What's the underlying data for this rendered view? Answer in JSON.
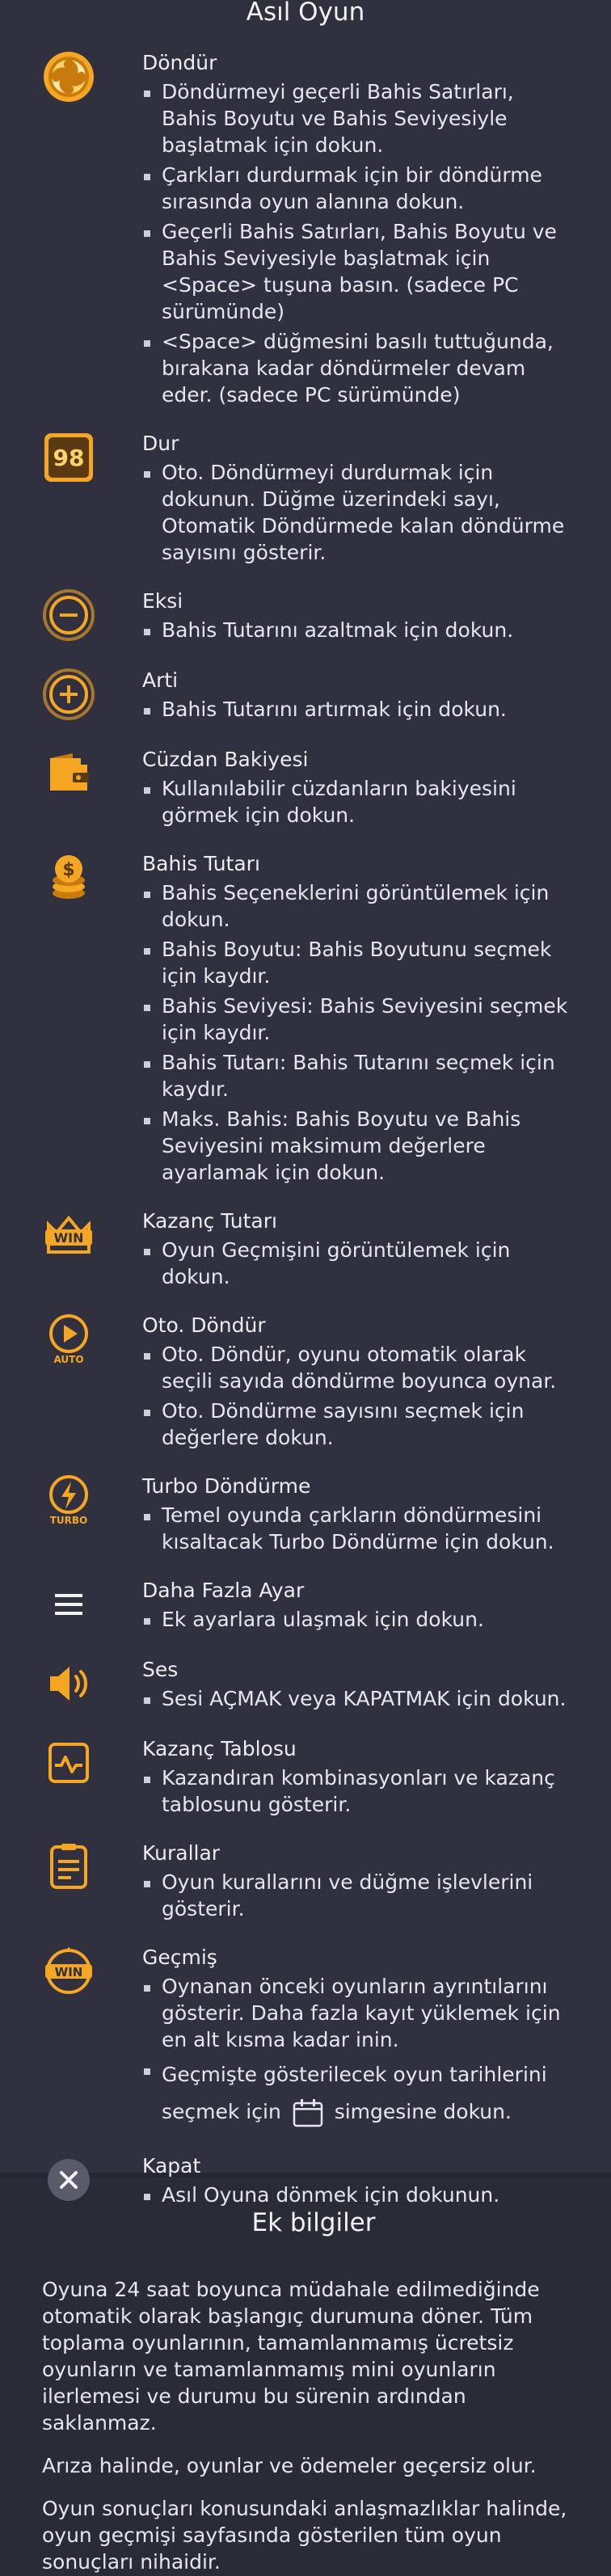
{
  "main_title": "Asıl Oyun",
  "colors": {
    "accent": "#f5a623",
    "background": "#30303e",
    "text": "#e9e9ef"
  },
  "items": [
    {
      "icon": "spin-icon",
      "name": "Döndür",
      "bullets": [
        "Döndürmeyi geçerli Bahis Satırları, Bahis Boyutu ve Bahis Seviyesiyle başlatmak için dokun.",
        "Çarkları durdurmak için bir döndürme sırasında oyun alanına dokun.",
        "Geçerli Bahis Satırları, Bahis Boyutu ve Bahis Seviyesiyle başlatmak için <Space> tuşuna basın. (sadece PC sürümünde)",
        "<Space> düğmesini basılı tuttuğunda, bırakana kadar döndürmeler devam eder. (sadece PC sürümünde)"
      ]
    },
    {
      "icon": "autospin-counter-icon",
      "icon_text": "98",
      "name": "Dur",
      "bullets": [
        "Oto. Döndürmeyi durdurmak için dokunun. Düğme üzerindeki sayı, Otomatik Döndürmede kalan döndürme sayısını gösterir."
      ]
    },
    {
      "icon": "minus-icon",
      "name": "Eksi",
      "bullets": [
        "Bahis Tutarını azaltmak için dokun."
      ]
    },
    {
      "icon": "plus-icon",
      "name": "Arti",
      "bullets": [
        "Bahis Tutarını artırmak için dokun."
      ]
    },
    {
      "icon": "wallet-icon",
      "name": "Cüzdan Bakiyesi",
      "bullets": [
        "Kullanılabilir cüzdanların bakiyesini görmek için dokun."
      ]
    },
    {
      "icon": "coins-icon",
      "name": "Bahis Tutarı",
      "bullets": [
        "Bahis Seçeneklerini görüntülemek için dokun.",
        "Bahis Boyutu: Bahis Boyutunu seçmek için kaydır.",
        "Bahis Seviyesi: Bahis Seviyesini seçmek için kaydır.",
        "Bahis Tutarı: Bahis Tutarını seçmek için kaydır.",
        "Maks. Bahis: Bahis Boyutu ve Bahis Seviyesini maksimum değerlere ayarlamak için dokun."
      ]
    },
    {
      "icon": "win-icon",
      "icon_text": "WIN",
      "name": "Kazanç Tutarı",
      "bullets": [
        "Oyun Geçmişini görüntülemek için dokun."
      ]
    },
    {
      "icon": "auto-play-icon",
      "icon_text": "AUTO",
      "name": "Oto. Döndür",
      "bullets": [
        "Oto. Döndür, oyunu otomatik olarak seçili sayıda döndürme boyunca oynar.",
        "Oto. Döndürme sayısını seçmek için değerlere dokun."
      ]
    },
    {
      "icon": "turbo-icon",
      "icon_text": "TURBO",
      "name": "Turbo Döndürme",
      "bullets": [
        "Temel oyunda çarkların döndürmesini kısaltacak Turbo Döndürme için dokun."
      ]
    },
    {
      "icon": "menu-icon",
      "name": "Daha Fazla Ayar",
      "bullets": [
        "Ek ayarlara ulaşmak için dokun."
      ]
    },
    {
      "icon": "sound-icon",
      "name": "Ses",
      "bullets": [
        "Sesi AÇMAK veya KAPATMAK için dokun."
      ]
    },
    {
      "icon": "paytable-icon",
      "name": "Kazanç Tablosu",
      "bullets": [
        "Kazandıran kombinasyonları ve kazanç tablosunu gösterir."
      ]
    },
    {
      "icon": "rules-icon",
      "name": "Kurallar",
      "bullets": [
        "Oyun kurallarını ve düğme işlevlerini gösterir."
      ]
    },
    {
      "icon": "history-icon",
      "icon_text": "WIN",
      "name": "Geçmiş",
      "bullets": [
        "Oynanan önceki oyunların ayrıntılarını gösterir. Daha fazla kayıt yüklemek için en alt kısma kadar inin."
      ],
      "calendar_bullet": {
        "before": "Geçmişte gösterilecek oyun tarihlerini seçmek için",
        "after": "simgesine dokun."
      }
    },
    {
      "icon": "close-icon",
      "name": "Kapat",
      "bullets": [
        "Asıl Oyuna dönmek için dokunun."
      ]
    }
  ],
  "extra": {
    "title": "Ek bilgiler",
    "paragraphs": [
      "Oyuna 24 saat boyunca müdahale edilmediğinde otomatik olarak başlangıç durumuna döner. Tüm toplama oyunlarının, tamamlanmamış ücretsiz oyunların ve tamamlanmamış mini oyunların ilerlemesi ve durumu bu sürenin ardından saklanmaz.",
      "Arıza halinde, oyunlar ve ödemeler geçersiz olur.",
      "Oyun sonuçları konusundaki anlaşmazlıklar halinde, oyun geçmişi sayfasında gösterilen tüm oyun sonuçları nihaidir."
    ]
  }
}
